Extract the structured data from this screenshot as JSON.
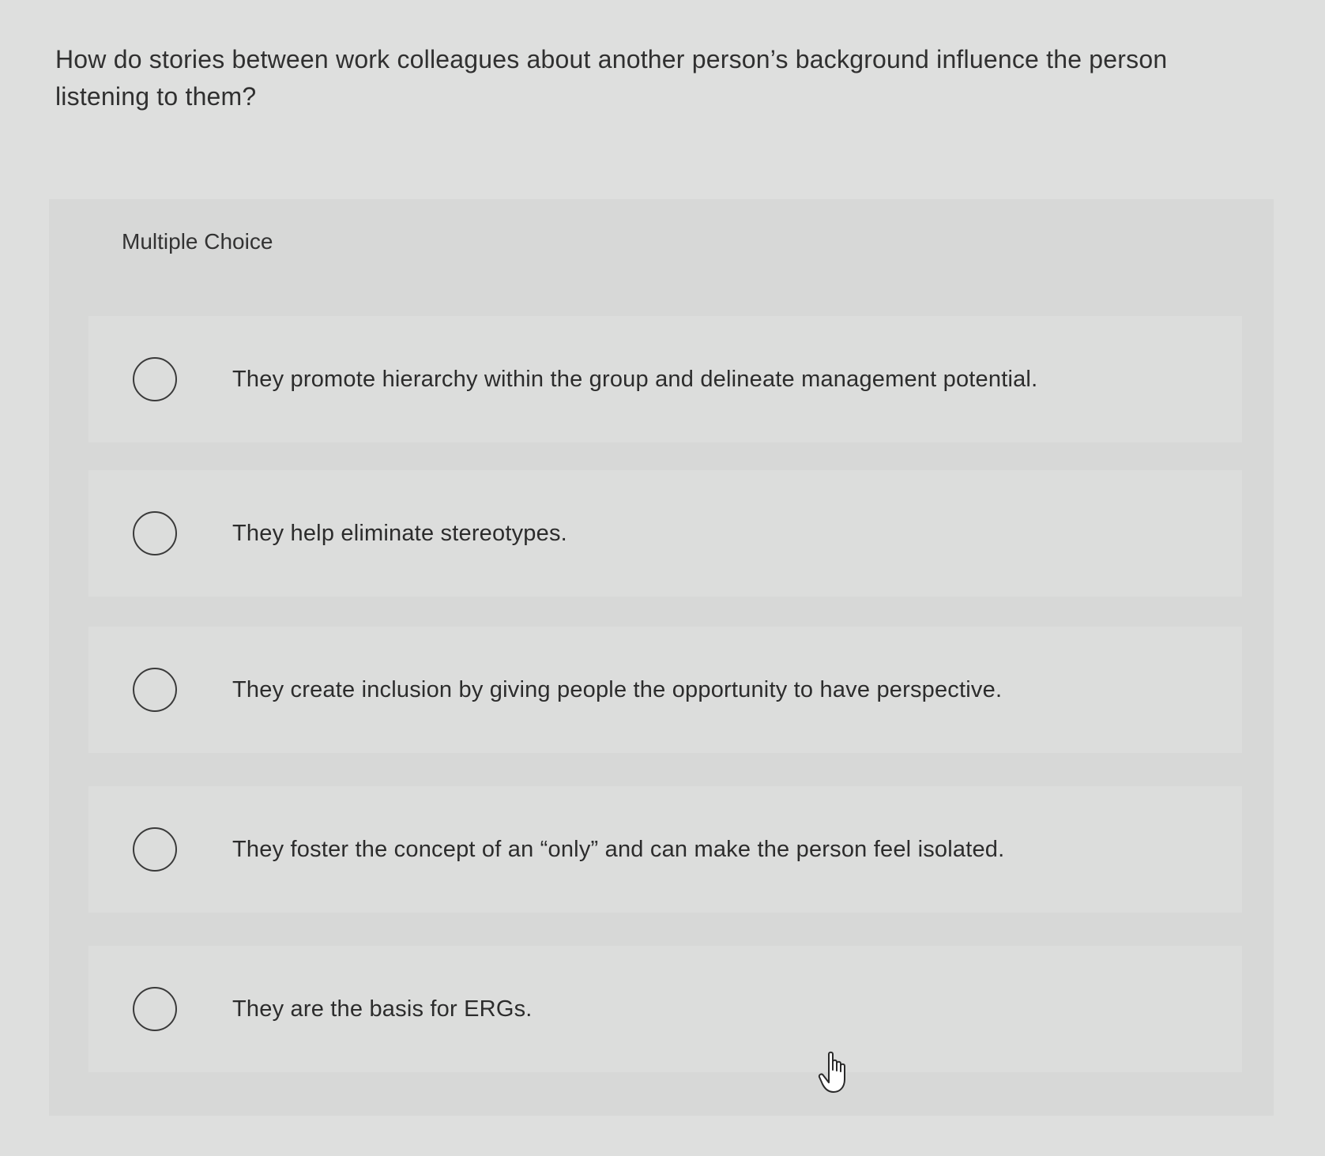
{
  "question": {
    "text": "How do stories between work colleagues about another person’s background influence the person listening to them?"
  },
  "answer_panel": {
    "type_label": "Multiple Choice",
    "options": [
      {
        "label": "They promote hierarchy within the group and delineate management potential.",
        "selected": false
      },
      {
        "label": "They help eliminate stereotypes.",
        "selected": false
      },
      {
        "label": "They create inclusion by giving people the opportunity to have perspective.",
        "selected": false
      },
      {
        "label": "They foster the concept of an “only” and can make the person feel isolated.",
        "selected": false
      },
      {
        "label": "They are the basis for ERGs.",
        "selected": false
      }
    ]
  },
  "icons": {
    "radio": "radio-button-icon",
    "cursor": "hand-pointer-cursor-icon"
  },
  "colors": {
    "background": "#dedfde",
    "panel": "#d7d8d7",
    "radio_border": "#3a3a3a",
    "text": "#2c2c2c"
  }
}
